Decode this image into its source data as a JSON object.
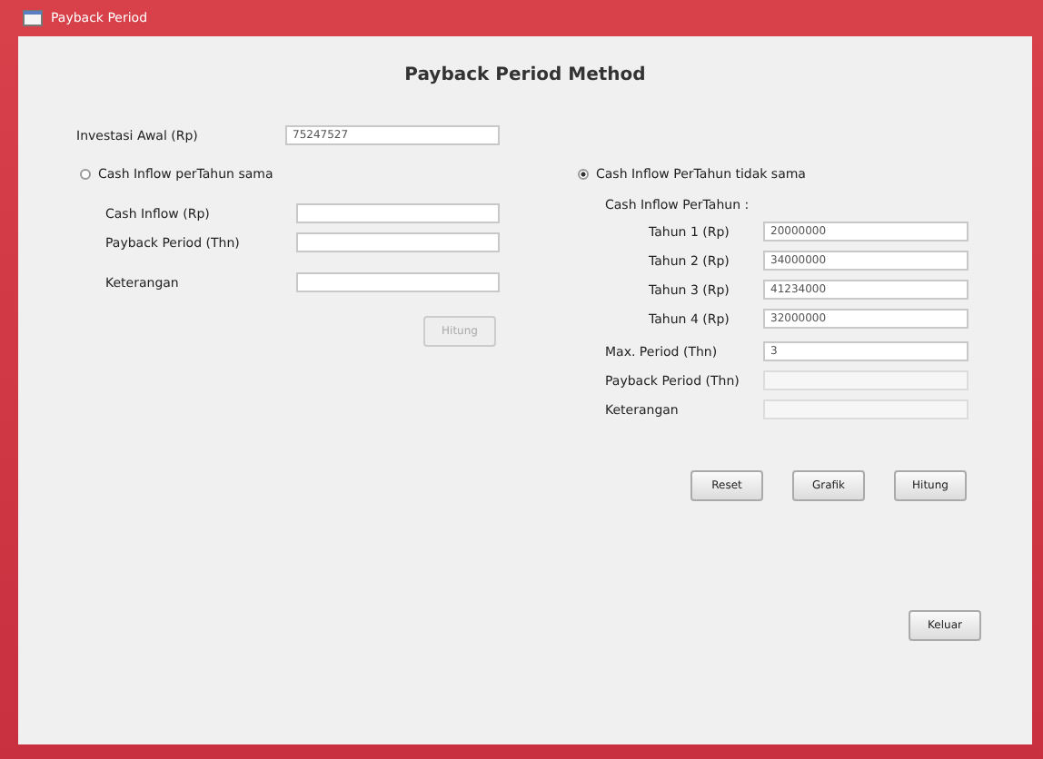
{
  "window": {
    "title": "Payback Period"
  },
  "heading": "Payback Period Method",
  "investment": {
    "label": "Investasi Awal (Rp)",
    "value": "75247527"
  },
  "left": {
    "option": {
      "label": "Cash Inflow perTahun sama",
      "selected": false
    },
    "fields": [
      {
        "label": "Cash Inflow (Rp)",
        "disabled": false
      },
      {
        "label": "Payback Period (Thn)",
        "disabled": false
      },
      {
        "label": "Keterangan",
        "disabled": false
      }
    ],
    "button": {
      "label": "Hitung",
      "disabled": true
    }
  },
  "right": {
    "option": {
      "label": "Cash Inflow PerTahun tidak sama",
      "selected": true
    },
    "group_label": "Cash Inflow PerTahun :",
    "years": [
      {
        "label": "Tahun 1 (Rp)",
        "value": "20000000"
      },
      {
        "label": "Tahun 2 (Rp)",
        "value": "34000000"
      },
      {
        "label": "Tahun 3 (Rp)",
        "value": "41234000"
      },
      {
        "label": "Tahun 4 (Rp)",
        "value": "32000000"
      }
    ],
    "fields": [
      {
        "label": "Max. Period (Thn)",
        "value": "3",
        "disabled": false
      },
      {
        "label": "Payback Period (Thn)",
        "disabled": true
      },
      {
        "label": "Keterangan",
        "disabled": true
      }
    ],
    "buttons": [
      "Reset",
      "Grafik",
      "Hitung"
    ]
  },
  "footer_button": "Keluar"
}
